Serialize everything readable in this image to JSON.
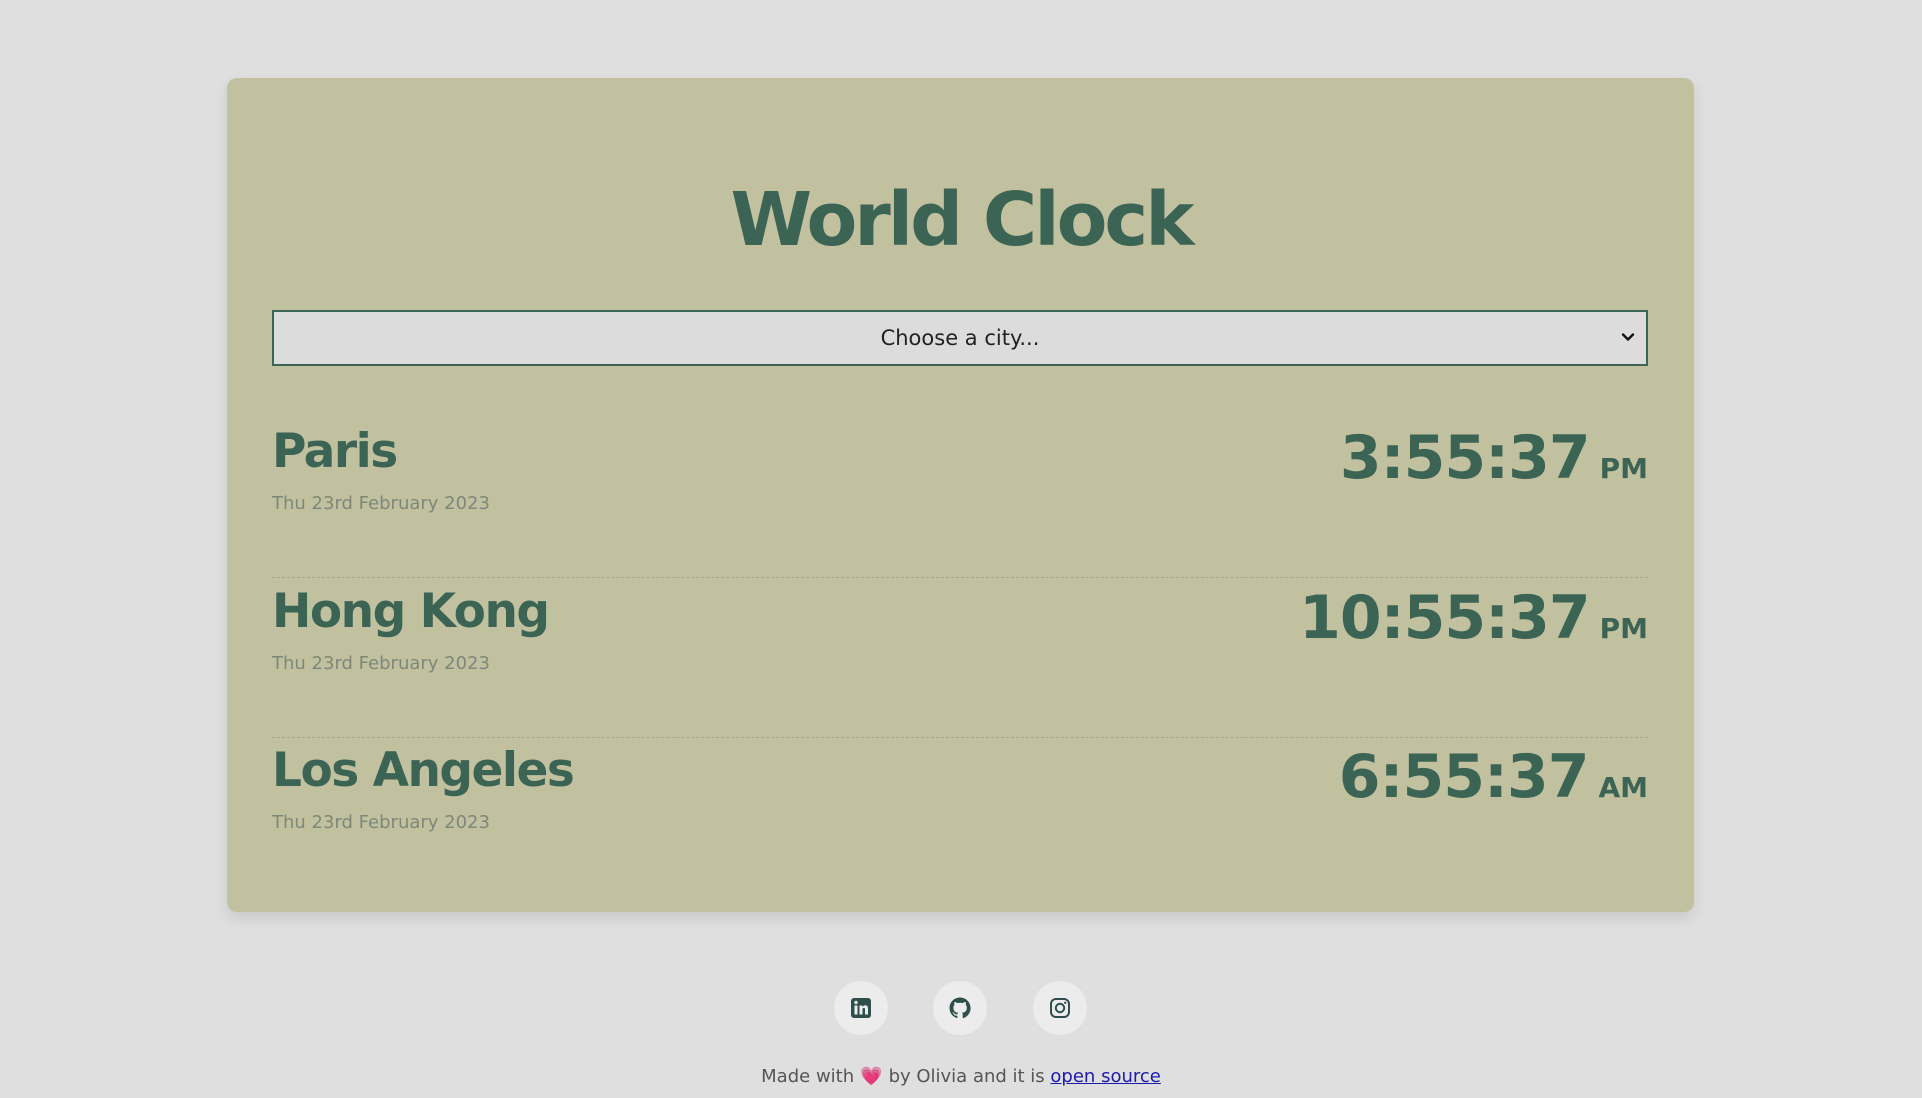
{
  "app": {
    "title": "World Clock"
  },
  "city_select": {
    "selected": "Choose a city..."
  },
  "cities": [
    {
      "name": "Paris",
      "date": "Thu 23rd February 2023",
      "time": "3:55:37",
      "ampm": "PM"
    },
    {
      "name": "Hong Kong",
      "date": "Thu 23rd February 2023",
      "time": "10:55:37",
      "ampm": "PM"
    },
    {
      "name": "Los Angeles",
      "date": "Thu 23rd February 2023",
      "time": "6:55:37",
      "ampm": "AM"
    }
  ],
  "social": {
    "icons": [
      "linkedin-icon",
      "github-icon",
      "instagram-icon"
    ]
  },
  "footer": {
    "made_with": "Made with",
    "heart": "💗",
    "by_text": "by Olivia and it is",
    "link_text": "open source"
  },
  "colors": {
    "background": "#dfdfdf",
    "card": "#c1c1a0",
    "accent": "#3b6455",
    "link": "#1c1aa8"
  }
}
